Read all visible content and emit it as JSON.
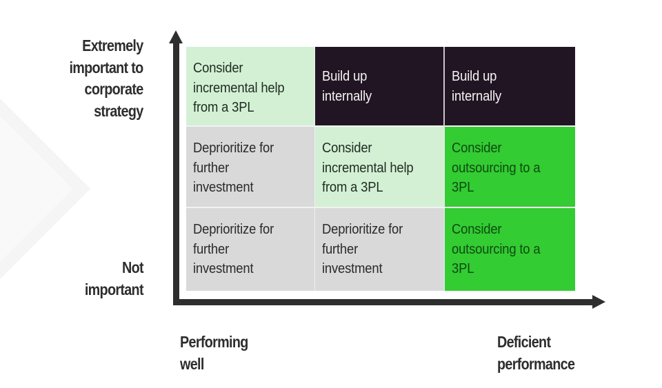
{
  "diagram": {
    "type": "3x3 decision matrix",
    "y_axis": {
      "top_label": "Extremely important to corporate strategy",
      "top_label_lines": [
        "Extremely",
        "important to",
        "corporate",
        "strategy"
      ],
      "bottom_label": "Not important",
      "bottom_label_lines": [
        "Not",
        "important"
      ]
    },
    "x_axis": {
      "left_label": "Performing well",
      "left_label_lines": [
        "Performing",
        "well"
      ],
      "right_label": "Deficient performance",
      "right_label_lines": [
        "Deficient",
        "performance"
      ]
    },
    "colors": {
      "light_green": "#d3f0d5",
      "dark_purple": "#221523",
      "gray": "#d9d9d9",
      "bright_green": "#33cc33",
      "axis": "#2e2e2e"
    },
    "rows": [
      {
        "importance": "high",
        "cells": [
          {
            "text": "Consider\nincremental help\nfrom a 3PL",
            "color": "light_green"
          },
          {
            "text": "Build up\ninternally",
            "color": "dark_purple"
          },
          {
            "text": "Build up\ninternally",
            "color": "dark_purple"
          }
        ]
      },
      {
        "importance": "medium",
        "cells": [
          {
            "text": "Deprioritize for\nfurther\ninvestment",
            "color": "gray"
          },
          {
            "text": "Consider\nincremental help\nfrom a 3PL",
            "color": "light_green"
          },
          {
            "text": "Consider\noutsourcing to a\n3PL",
            "color": "bright_green"
          }
        ]
      },
      {
        "importance": "low",
        "cells": [
          {
            "text": "Deprioritize for\nfurther\ninvestment",
            "color": "gray"
          },
          {
            "text": "Deprioritize for\nfurther\ninvestment",
            "color": "gray"
          },
          {
            "text": "Consider\noutsourcing to a\n3PL",
            "color": "bright_green"
          }
        ]
      }
    ]
  }
}
